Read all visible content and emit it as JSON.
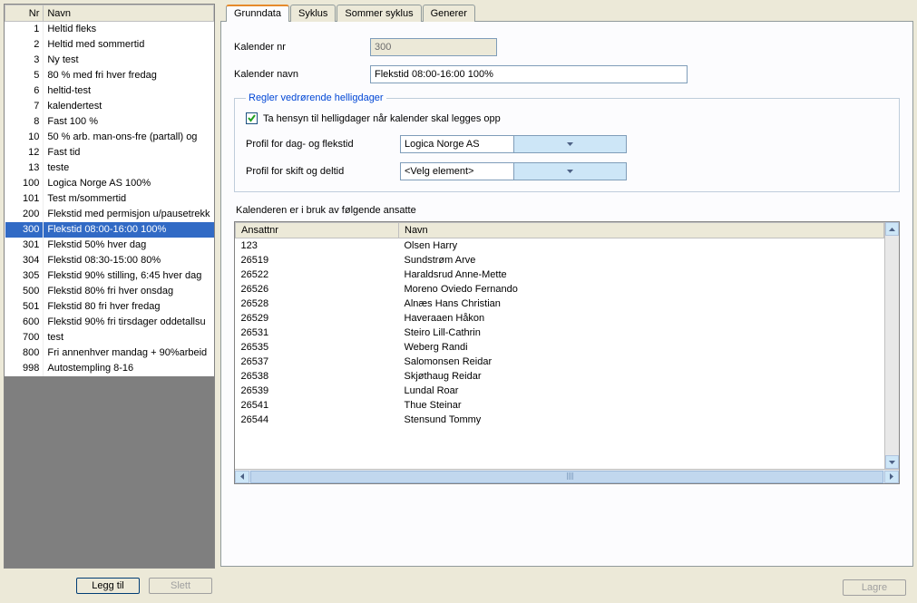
{
  "left": {
    "headers": {
      "nr": "Nr",
      "navn": "Navn"
    },
    "rows": [
      {
        "nr": "1",
        "navn": "Heltid fleks"
      },
      {
        "nr": "2",
        "navn": "Heltid med sommertid"
      },
      {
        "nr": "3",
        "navn": "Ny test"
      },
      {
        "nr": "5",
        "navn": "80 % med fri hver fredag"
      },
      {
        "nr": "6",
        "navn": "heltid-test"
      },
      {
        "nr": "7",
        "navn": "kalendertest"
      },
      {
        "nr": "8",
        "navn": "Fast 100 %"
      },
      {
        "nr": "10",
        "navn": "50 % arb. man-ons-fre (partall) og"
      },
      {
        "nr": "12",
        "navn": "Fast tid"
      },
      {
        "nr": "13",
        "navn": "teste"
      },
      {
        "nr": "100",
        "navn": "Logica Norge AS 100%"
      },
      {
        "nr": "101",
        "navn": "Test m/sommertid"
      },
      {
        "nr": "200",
        "navn": "Flekstid med permisjon u/pausetrekk"
      },
      {
        "nr": "300",
        "navn": "Flekstid 08:00-16:00 100%"
      },
      {
        "nr": "301",
        "navn": "Flekstid 50% hver dag"
      },
      {
        "nr": "304",
        "navn": "Flekstid 08:30-15:00 80%"
      },
      {
        "nr": "305",
        "navn": "Flekstid 90% stilling, 6:45 hver dag"
      },
      {
        "nr": "500",
        "navn": "Flekstid 80% fri hver onsdag"
      },
      {
        "nr": "501",
        "navn": "Flekstid 80  fri hver fredag"
      },
      {
        "nr": "600",
        "navn": "Flekstid 90% fri tirsdager oddetallsu"
      },
      {
        "nr": "700",
        "navn": "test"
      },
      {
        "nr": "800",
        "navn": "Fri annenhver mandag + 90%arbeid"
      },
      {
        "nr": "998",
        "navn": "Autostempling 8-16"
      }
    ],
    "selected_nr": "300",
    "btn_add": "Legg til",
    "btn_delete": "Slett"
  },
  "tabs": [
    "Grunndata",
    "Syklus",
    "Sommer syklus",
    "Generer"
  ],
  "active_tab": 0,
  "form": {
    "kalender_nr_label": "Kalender nr",
    "kalender_nr_value": "300",
    "kalender_navn_label": "Kalender navn",
    "kalender_navn_value": "Flekstid 08:00-16:00 100%",
    "legend": "Regler vedrørende helligdager",
    "chk_label": "Ta hensyn til helligdager når kalender skal legges opp",
    "chk_checked": true,
    "profil_dag_label": "Profil for dag- og flekstid",
    "profil_dag_value": "Logica Norge AS",
    "profil_skift_label": "Profil for skift og deltid",
    "profil_skift_value": "<Velg element>"
  },
  "employees": {
    "title": "Kalenderen er i bruk av følgende ansatte",
    "headers": {
      "ansattnr": "Ansattnr",
      "navn": "Navn"
    },
    "rows": [
      {
        "nr": "123",
        "navn": "Olsen Harry"
      },
      {
        "nr": "26519",
        "navn": "Sundstrøm Arve"
      },
      {
        "nr": "26522",
        "navn": "Haraldsrud Anne-Mette"
      },
      {
        "nr": "26526",
        "navn": "Moreno Oviedo Fernando"
      },
      {
        "nr": "26528",
        "navn": "Alnæs Hans Christian"
      },
      {
        "nr": "26529",
        "navn": "Haveraaen Håkon"
      },
      {
        "nr": "26531",
        "navn": "Steiro Lill-Cathrin"
      },
      {
        "nr": "26535",
        "navn": "Weberg Randi"
      },
      {
        "nr": "26537",
        "navn": "Salomonsen Reidar"
      },
      {
        "nr": "26538",
        "navn": "Skjøthaug Reidar"
      },
      {
        "nr": "26539",
        "navn": "Lundal Roar"
      },
      {
        "nr": "26541",
        "navn": "Thue Steinar"
      },
      {
        "nr": "26544",
        "navn": "Stensund Tommy"
      }
    ],
    "selected_nr": "123"
  },
  "btn_save": "Lagre"
}
